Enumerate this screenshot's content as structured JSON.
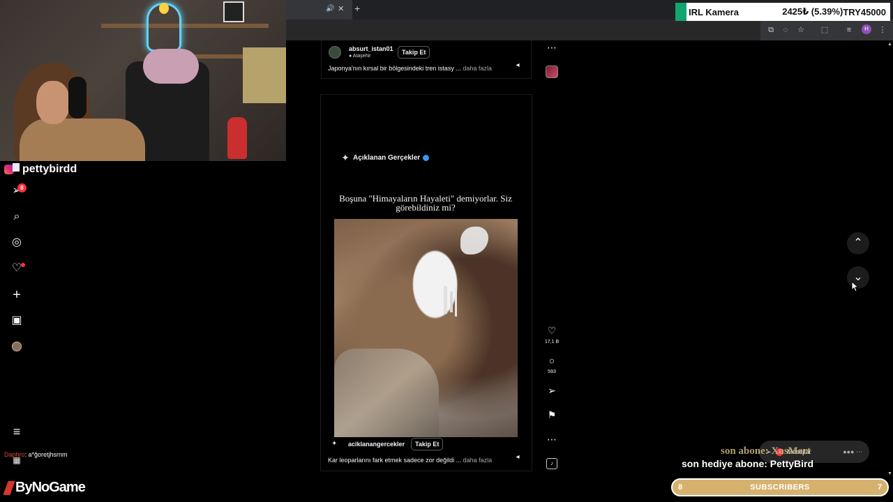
{
  "overlay": {
    "ticker": {
      "name": "IRL Kamera",
      "price": "2425₺ (5.39%)",
      "goal": "TRY45000"
    },
    "instagram_handle": "pettybirdd",
    "chat": {
      "user": "Daphro",
      "message": ": a*ğoretjhsrnm"
    },
    "brand": "ByNoGame",
    "last_sub_ticker": "son abone: XasMert",
    "last_gift": "son hediye abone: PettyBird",
    "subscribers": {
      "current": "8",
      "label": "SUBSCRIBERS",
      "goal": "7"
    }
  },
  "sidebar": {
    "notification_count": "8",
    "items": [
      "home",
      "search",
      "explore",
      "notifications",
      "create",
      "dashboard",
      "profile",
      "more",
      "meta"
    ]
  },
  "feed": {
    "post1": {
      "username": "absurt_istan01",
      "location": "Ataşehir",
      "follow_label": "Takip Et",
      "caption": "Japonya'nın kırsal bir bölgesindeki tren istasy ...",
      "more_label": "daha fazla"
    },
    "reel": {
      "brand": "Açıklanan Gerçekler",
      "headline": "Boşuna \"Himayaların Hayaleti\" demiyorlar. Siz görebildiniz mi?",
      "username": "aciklanangercekler",
      "follow_label": "Takip Et",
      "caption": "Kar leoparlarını fark etmek sadece zor değildi ...",
      "more_label": "daha fazla",
      "likes": "17,1 B",
      "comments": "593"
    }
  },
  "messages": {
    "label": "Mesajlar",
    "badge": "7"
  },
  "colors": {
    "accent_red": "#ff3040",
    "verified": "#3897f0",
    "sub_bar": "#d6b16e"
  }
}
